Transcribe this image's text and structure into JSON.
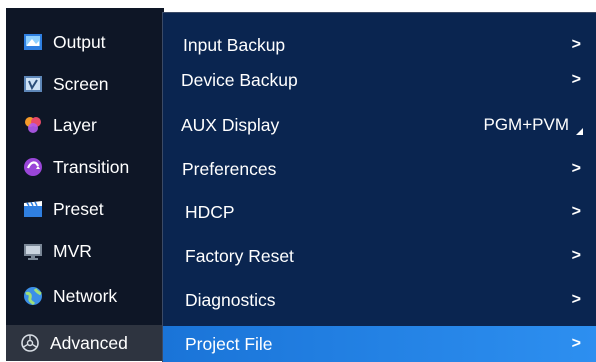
{
  "sidebar": {
    "items": [
      {
        "label": "Output",
        "icon": "output-icon"
      },
      {
        "label": "Screen",
        "icon": "screen-icon"
      },
      {
        "label": "Layer",
        "icon": "layer-icon"
      },
      {
        "label": "Transition",
        "icon": "transition-icon"
      },
      {
        "label": "Preset",
        "icon": "preset-icon"
      },
      {
        "label": "MVR",
        "icon": "mvr-icon"
      },
      {
        "label": "Network",
        "icon": "network-icon"
      },
      {
        "label": "Advanced",
        "icon": "gear-icon"
      }
    ],
    "active": "Advanced"
  },
  "submenu": {
    "items": [
      {
        "label": "Input Backup",
        "chevron": ">"
      },
      {
        "label": "Device Backup",
        "chevron": ">"
      },
      {
        "label": "AUX Display",
        "value": "PGM+PVM"
      },
      {
        "label": "Preferences",
        "chevron": ">"
      },
      {
        "label": "HDCP",
        "chevron": ">"
      },
      {
        "label": "Factory Reset",
        "chevron": ">"
      },
      {
        "label": "Diagnostics",
        "chevron": ">"
      },
      {
        "label": "Project File",
        "chevron": ">"
      }
    ],
    "selected": "Project File"
  },
  "colors": {
    "sidebar_bg": "#0e1626",
    "submenu_bg": "#0a2550",
    "selected_bg": "#1f7fe6"
  }
}
